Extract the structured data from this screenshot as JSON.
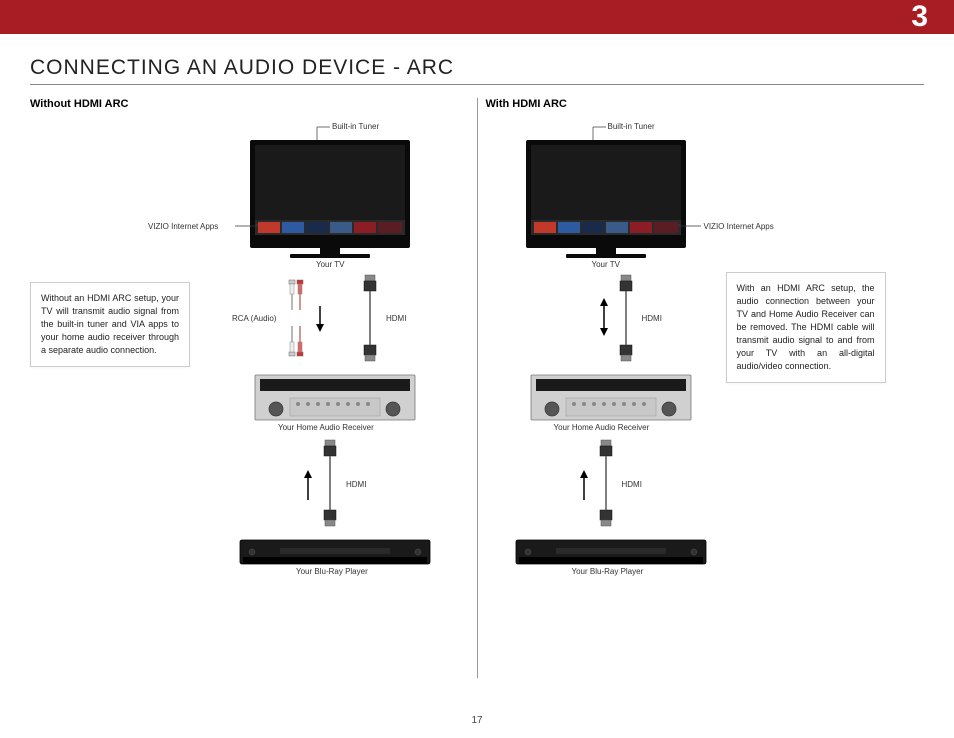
{
  "chapter": "3",
  "page_title": "CONNECTING AN AUDIO DEVICE - ARC",
  "page_number": "17",
  "left": {
    "heading": "Without HDMI ARC",
    "info": "Without an HDMI ARC setup, your TV will transmit audio signal from the built-in tuner and VIA apps to your home audio receiver through a separate audio connection.",
    "labels": {
      "tuner": "Built-in Tuner",
      "apps": "VIZIO Internet  Apps",
      "tv": "Your TV",
      "rca": "RCA (Audio)",
      "hdmi1": "HDMI",
      "receiver": "Your Home Audio Receiver",
      "hdmi2": "HDMI",
      "bluray": "Your Blu-Ray Player"
    }
  },
  "right": {
    "heading": "With HDMI ARC",
    "info": "With an HDMI ARC setup, the audio connection between your TV and Home Audio Receiver can be removed. The HDMI cable will transmit audio signal to and from your TV with an all-digital audio/video connection.",
    "labels": {
      "tuner": "Built-in Tuner",
      "apps": "VIZIO Internet  Apps",
      "tv": "Your TV",
      "hdmi1": "HDMI",
      "receiver": "Your Home Audio Receiver",
      "hdmi2": "HDMI",
      "bluray": "Your Blu-Ray Player"
    }
  }
}
